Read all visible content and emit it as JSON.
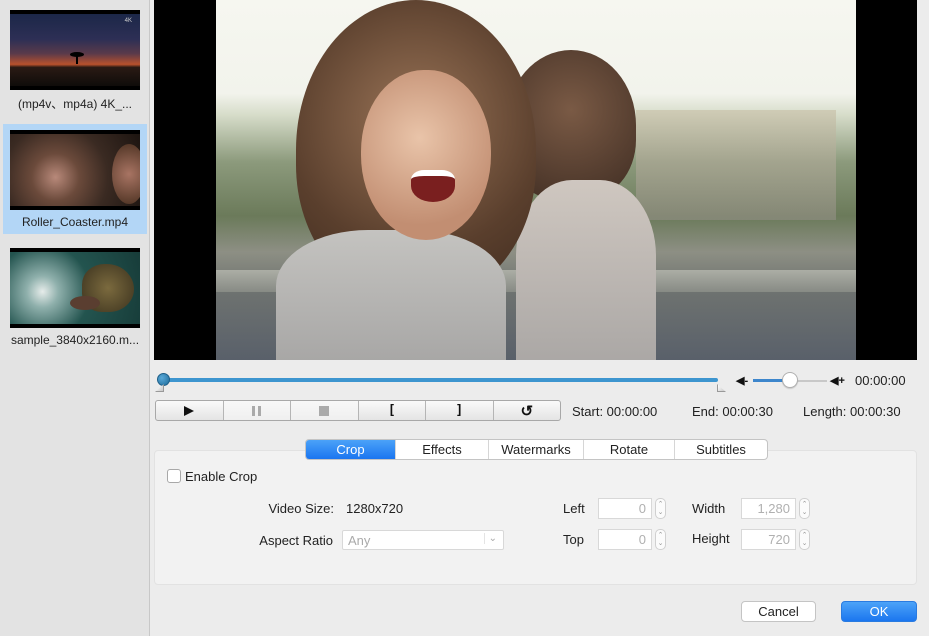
{
  "sidebar": {
    "items": [
      {
        "name": "(mp4v、mp4a) 4K_...",
        "thumbnail": "sunset-with-tree",
        "badge": "4K",
        "selected": false
      },
      {
        "name": "Roller_Coaster.mp4",
        "thumbnail": "roller-coaster-riders",
        "selected": true
      },
      {
        "name": "sample_3840x2160.m...",
        "thumbnail": "aerial-ocean-rocks",
        "selected": false
      }
    ]
  },
  "player": {
    "preview": "two-women-laughing-outdoors",
    "progress": 0,
    "volume": 0.5,
    "current_time": "00:00:00",
    "volume_down_icon": "◀-",
    "volume_up_icon": "◀+",
    "controls": {
      "play": "play-icon",
      "pause": "pause-icon",
      "stop": "stop-icon",
      "set_start": "[",
      "set_end": "]",
      "reset": "↺"
    },
    "start": "Start: 00:00:00",
    "end": "End: 00:00:30",
    "length": "Length: 00:00:30"
  },
  "tabs": [
    {
      "label": "Crop",
      "active": true
    },
    {
      "label": "Effects",
      "active": false
    },
    {
      "label": "Watermarks",
      "active": false
    },
    {
      "label": "Rotate",
      "active": false
    },
    {
      "label": "Subtitles",
      "active": false
    }
  ],
  "crop": {
    "enable_label": "Enable Crop",
    "enabled": false,
    "video_size_label": "Video Size:",
    "video_size_value": "1280x720",
    "aspect_ratio_label": "Aspect Ratio",
    "aspect_ratio_value": "Any",
    "left_label": "Left",
    "left_value": "0",
    "top_label": "Top",
    "top_value": "0",
    "width_label": "Width",
    "width_value": "1,280",
    "height_label": "Height",
    "height_value": "720"
  },
  "footer": {
    "cancel_label": "Cancel",
    "ok_label": "OK"
  },
  "colors": {
    "accent": "#1a75f0",
    "timeline": "#3d95cf",
    "selection": "#b3d6f6"
  }
}
